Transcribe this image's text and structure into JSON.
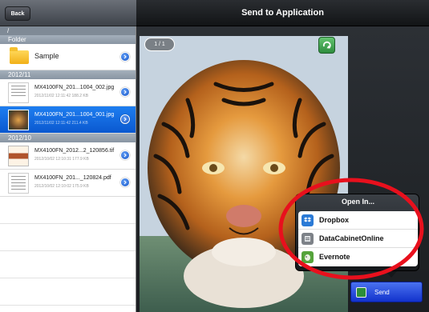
{
  "header": {
    "back_label": "Back",
    "title": "Send to Application"
  },
  "sidebar": {
    "path": "/",
    "sections": [
      {
        "title": "Folder"
      },
      {
        "title": "2012/11"
      },
      {
        "title": "2012/10"
      }
    ],
    "folder": {
      "name": "Sample"
    },
    "files": [
      {
        "name": "MX4100FN_201...1004_002.jpg",
        "meta": "2012/11/02 12:11:42   188.2 KB"
      },
      {
        "name": "MX4100FN_201...1004_001.jpg",
        "meta": "2012/11/02 12:11:42   211.4 KB",
        "selected": true
      },
      {
        "name": "MX4100FN_2012...2_120856.tif",
        "meta": "2012/10/02 12:10:31   177.9 KB"
      },
      {
        "name": "MX4100FN_201..._120824.pdf",
        "meta": "2012/10/02 12:10:02   175.9 KB"
      }
    ]
  },
  "preview": {
    "page_indicator": "1 / 1",
    "rotate_icon": "rotate-icon",
    "image_subject": "tiger-photo"
  },
  "open_in_menu": {
    "title": "Open In...",
    "items": [
      {
        "label": "Dropbox",
        "icon": "dropbox-icon",
        "color": "#2a7ad6"
      },
      {
        "label": "DataCabinetOnline",
        "icon": "datacabinet-icon",
        "color": "#7d8288"
      },
      {
        "label": "Evernote",
        "icon": "evernote-icon",
        "color": "#55a33b"
      }
    ]
  },
  "send": {
    "label": "Send",
    "icon": "send-icon"
  },
  "colors": {
    "selection_blue": "#1e7ef0",
    "annotation_red": "#e8101d"
  }
}
